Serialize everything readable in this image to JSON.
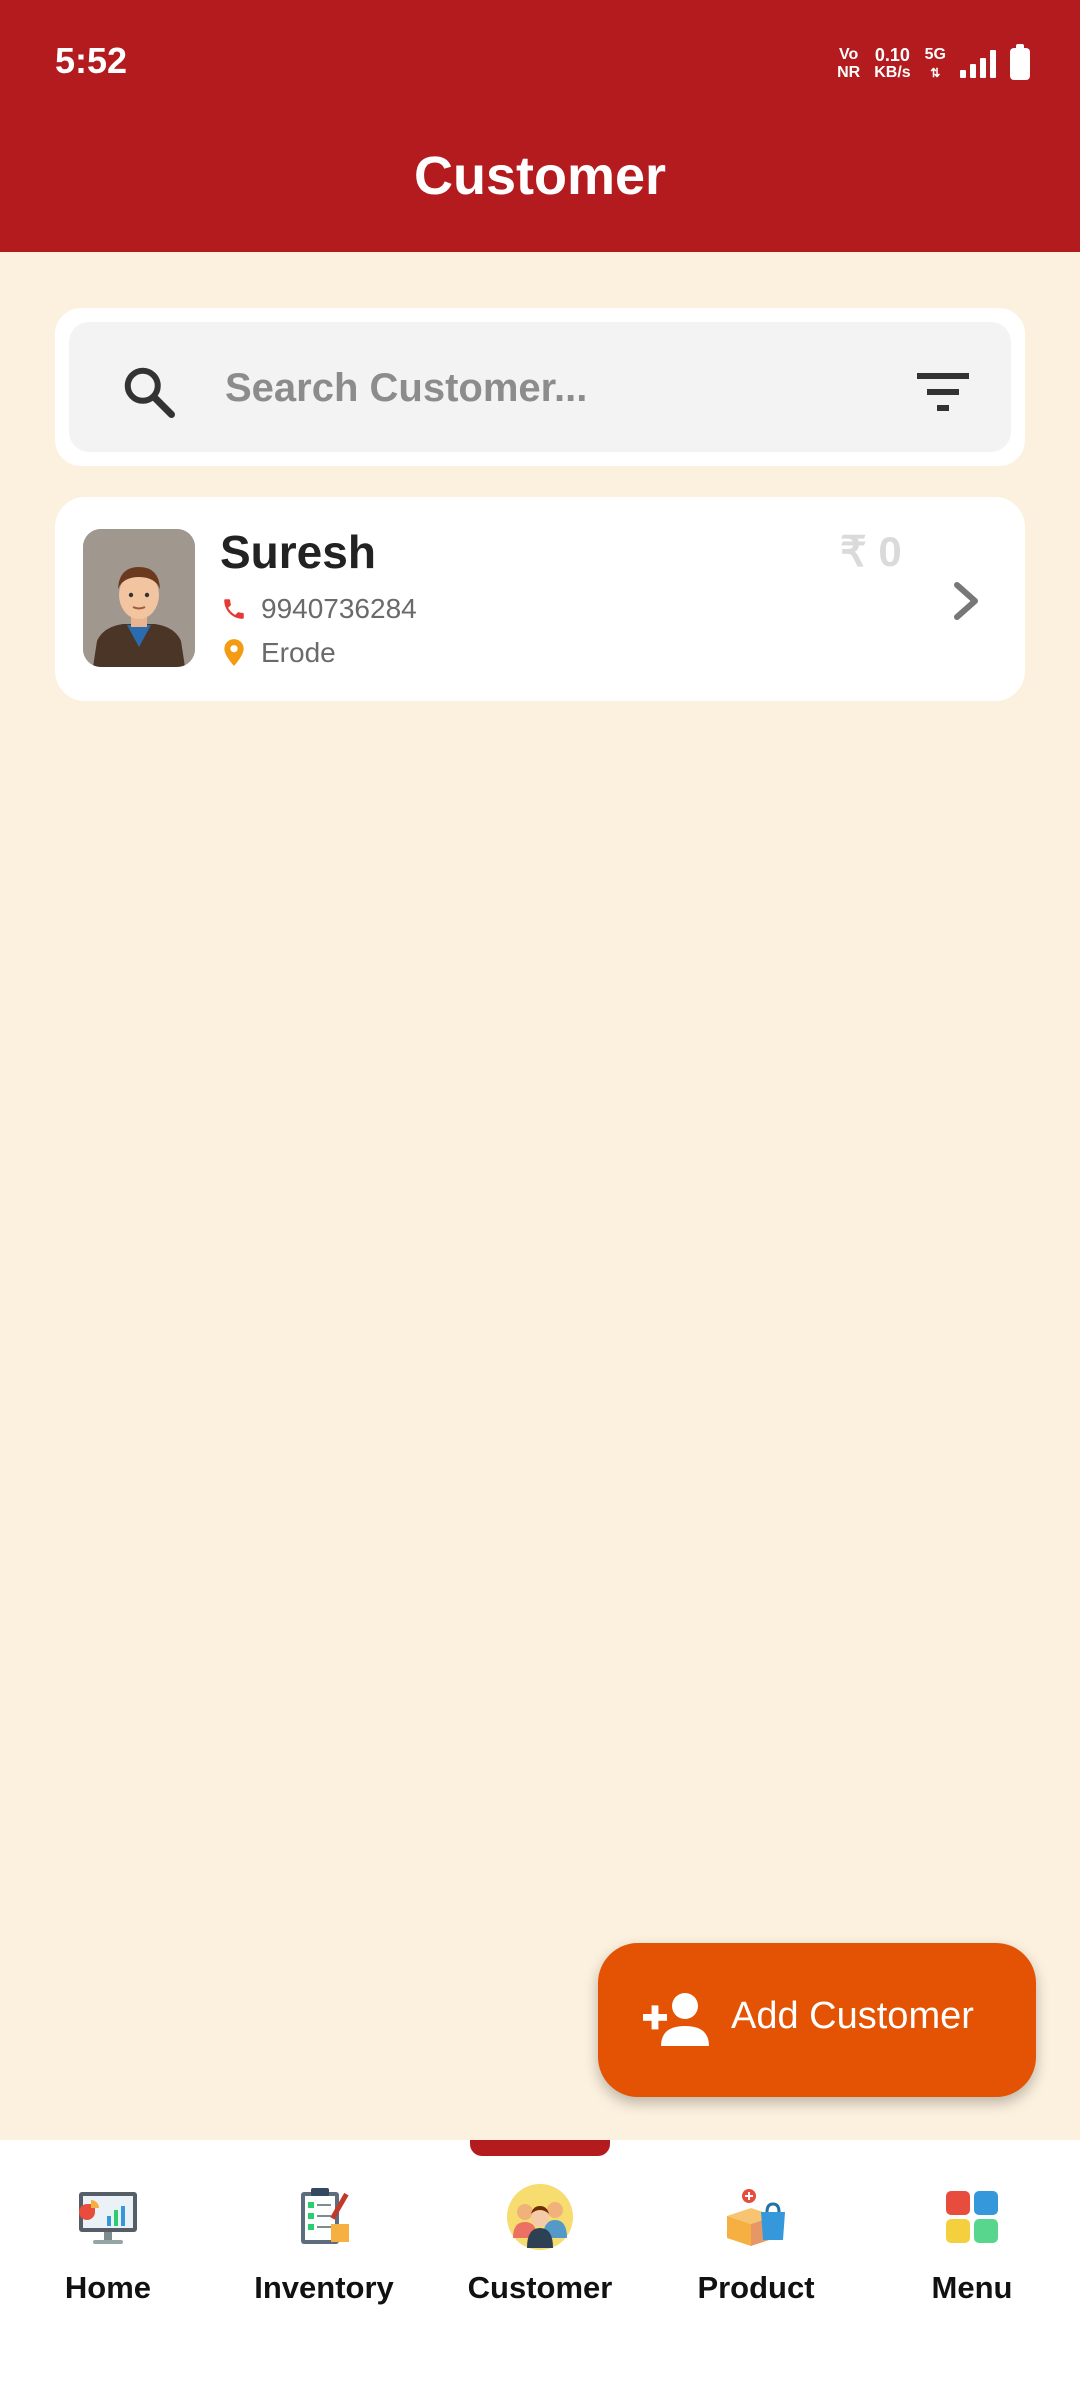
{
  "status_bar": {
    "time": "5:52",
    "volte_top": "Vo",
    "volte_bottom": "NR",
    "speed_value": "0.10",
    "speed_unit": "KB/s",
    "network": "5G"
  },
  "header": {
    "title": "Customer"
  },
  "search": {
    "placeholder": "Search Customer..."
  },
  "customers": [
    {
      "name": "Suresh",
      "phone": "9940736284",
      "location": "Erode",
      "amount": "₹ 0"
    }
  ],
  "fab": {
    "label": "Add Customer"
  },
  "bottom_nav": {
    "items": [
      {
        "label": "Home",
        "icon": "dashboard-monitor-icon"
      },
      {
        "label": "Inventory",
        "icon": "clipboard-checklist-icon"
      },
      {
        "label": "Customer",
        "icon": "customers-group-icon"
      },
      {
        "label": "Product",
        "icon": "product-box-icon"
      },
      {
        "label": "Menu",
        "icon": "grid-menu-icon"
      }
    ],
    "active": "Customer"
  },
  "colors": {
    "header": "#B31B1F",
    "background": "#FCF0DE",
    "fab": "#E45203",
    "phone_icon": "#E53935",
    "location_icon": "#F39C12"
  }
}
